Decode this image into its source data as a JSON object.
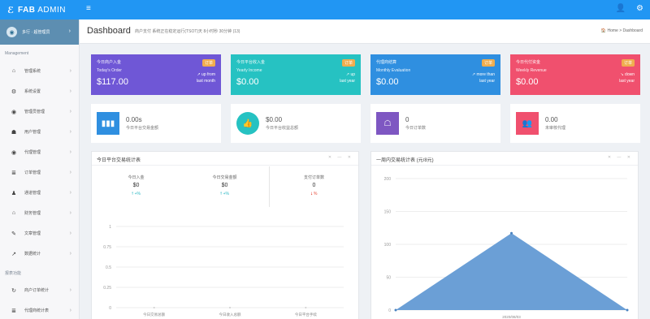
{
  "topbar": {
    "logo_mark": "ℰ",
    "logo_brand": "FAB",
    "logo_rest": " ADMIN",
    "menu_icon": "≡",
    "user_icon": "👤",
    "gear_icon": "⚙"
  },
  "sidebar": {
    "user_name": "多行 · 超管理员",
    "section_main": "Management",
    "section_reports": "报表功能",
    "items": [
      {
        "icon": "⌂",
        "label": "管理系统"
      },
      {
        "icon": "⚙",
        "label": "系统设置"
      },
      {
        "icon": "◉",
        "label": "管理员管理"
      },
      {
        "icon": "☗",
        "label": "用户管理"
      },
      {
        "icon": "◉",
        "label": "代理管理"
      },
      {
        "icon": "≣",
        "label": "订单管理"
      },
      {
        "icon": "♟",
        "label": "通道管理"
      },
      {
        "icon": "⌂",
        "label": "财务管理"
      },
      {
        "icon": "✎",
        "label": "文章管理"
      },
      {
        "icon": "↗",
        "label": "数据统计"
      }
    ],
    "report_items": [
      {
        "icon": "↻",
        "label": "商户订单统计"
      },
      {
        "icon": "≣",
        "label": "代理商统计表"
      }
    ]
  },
  "page": {
    "title": "Dashboard",
    "subtitle": "商户支付 系统正在稳定运行(TSOT)天 8小时秒 30分钟 (13)",
    "breadcrumb": "🏠 Home > Dashboard"
  },
  "stats": [
    {
      "label": "今日商户入金",
      "sub": "Today's Order",
      "value": "$117.00",
      "badge": "订单",
      "trend1": "↗ up from",
      "trend2": "last month",
      "color": "#6f57d6"
    },
    {
      "label": "今日平台收入金",
      "sub": "Yearly Income",
      "value": "$0.00",
      "badge": "订单",
      "trend1": "↗ up",
      "trend2": "last year",
      "color": "#26c2c2"
    },
    {
      "label": "代理商结算",
      "sub": "Monthly Evaluation",
      "value": "$0.00",
      "badge": "订单",
      "trend1": "↗ more than",
      "trend2": "last year",
      "color": "#2f8fe0"
    },
    {
      "label": "今日代付资金",
      "sub": "Weekly Revenue",
      "value": "$0.00",
      "badge": "订单",
      "trend1": "↘ down",
      "trend2": "last year",
      "color": "#f0506e"
    }
  ],
  "infos": [
    {
      "icon": "▮▮▮",
      "value": "0.00s",
      "label": "今日平台交易金额",
      "color": "#2f8fe0",
      "round": false
    },
    {
      "icon": "👍",
      "value": "$0.00",
      "label": "今日平台收益总额",
      "color": "#26c2c2",
      "round": true
    },
    {
      "icon": "☖",
      "value": "0",
      "label": "今日订单数",
      "color": "#7e57c2",
      "round": false
    },
    {
      "icon": "👥",
      "value": "0.00",
      "label": "未审核代理",
      "color": "#f0506e",
      "round": false
    }
  ],
  "panel_left": {
    "title": "今日平台交易统计表",
    "tools": "✕ — ✕",
    "kpis": [
      {
        "label": "今日入金",
        "value": "$0",
        "delta": "🠕 +%",
        "trend": "up"
      },
      {
        "label": "今日交易金额",
        "value": "$0",
        "delta": "🠕 +%",
        "trend": "up"
      },
      {
        "label": "支付订单数",
        "value": "0",
        "delta": "🠗 %",
        "trend": "down"
      }
    ]
  },
  "panel_right": {
    "title": "一周内交易统计表 (元/8元)",
    "tools": "✕ — ✕"
  },
  "chart_data": [
    {
      "type": "line",
      "categories": [
        "今日交易总额",
        "今日收入总额",
        "今日平台手续"
      ],
      "series": [
        {
          "values": [
            0,
            0,
            0
          ]
        }
      ],
      "ylim": [
        0,
        1
      ],
      "yticks": [
        "1",
        "0.75",
        "0.5",
        "0.25",
        "0"
      ],
      "grid": true
    },
    {
      "type": "area",
      "categories": [
        "",
        "2020/08/03",
        ""
      ],
      "series": [
        {
          "values": [
            0,
            117,
            0
          ]
        }
      ],
      "ylim": [
        0,
        200
      ],
      "yticks": [
        "200",
        "150",
        "100",
        "50",
        "0"
      ],
      "color": "#6b9fd6",
      "grid": true
    }
  ]
}
